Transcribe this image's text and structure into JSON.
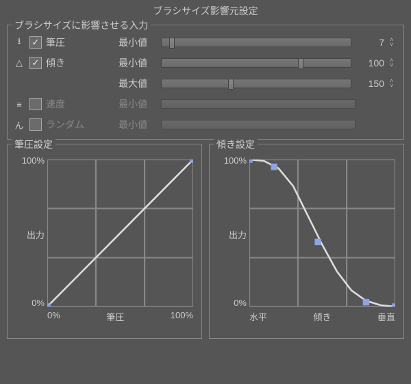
{
  "title": "ブラシサイズ影響元設定",
  "section_label": "ブラシサイズに影響させる入力",
  "inputs": {
    "pressure": {
      "icon": "⭳",
      "label": "筆圧",
      "checked": true,
      "enabled": true,
      "params": [
        {
          "label": "最小値",
          "value": 7,
          "thumb_pct": 4
        }
      ]
    },
    "tilt": {
      "icon": "△",
      "label": "傾き",
      "checked": true,
      "enabled": true,
      "params": [
        {
          "label": "最小値",
          "value": 100,
          "thumb_pct": 72
        },
        {
          "label": "最大値",
          "value": 150,
          "thumb_pct": 35
        }
      ]
    },
    "speed": {
      "icon": "≡",
      "label": "速度",
      "checked": false,
      "enabled": false,
      "params": [
        {
          "label": "最小値",
          "value": "",
          "thumb_pct": 0
        }
      ]
    },
    "random": {
      "icon": "ん",
      "label": "ランダム",
      "checked": false,
      "enabled": false,
      "params": [
        {
          "label": "最小値",
          "value": "",
          "thumb_pct": 0
        }
      ]
    }
  },
  "chart_data": [
    {
      "type": "line",
      "title": "筆圧設定",
      "ylabel": "出力",
      "y_ticks": [
        "100%",
        "出力",
        "0%"
      ],
      "x_ticks": [
        "0%",
        "筆圧",
        "100%"
      ],
      "xlim": [
        0,
        100
      ],
      "ylim": [
        0,
        100
      ],
      "series": [
        {
          "name": "curve",
          "points": [
            {
              "x": 0,
              "y": 0
            },
            {
              "x": 100,
              "y": 100
            }
          ]
        }
      ],
      "handles": [
        {
          "x": 0,
          "y": 0
        },
        {
          "x": 100,
          "y": 100
        }
      ]
    },
    {
      "type": "line",
      "title": "傾き設定",
      "ylabel": "出力",
      "y_ticks": [
        "100%",
        "出力",
        "0%"
      ],
      "x_ticks": [
        "水平",
        "傾き",
        "垂直"
      ],
      "xlim": [
        0,
        100
      ],
      "ylim": [
        0,
        100
      ],
      "series": [
        {
          "name": "curve",
          "points": [
            {
              "x": 0,
              "y": 100
            },
            {
              "x": 10,
              "y": 99
            },
            {
              "x": 20,
              "y": 94
            },
            {
              "x": 30,
              "y": 82
            },
            {
              "x": 40,
              "y": 62
            },
            {
              "x": 50,
              "y": 42
            },
            {
              "x": 60,
              "y": 24
            },
            {
              "x": 70,
              "y": 11
            },
            {
              "x": 80,
              "y": 4
            },
            {
              "x": 90,
              "y": 1
            },
            {
              "x": 100,
              "y": 0
            }
          ]
        }
      ],
      "handles": [
        {
          "x": 0,
          "y": 100
        },
        {
          "x": 17,
          "y": 95
        },
        {
          "x": 47,
          "y": 44
        },
        {
          "x": 80,
          "y": 3
        },
        {
          "x": 100,
          "y": 0
        }
      ]
    }
  ]
}
